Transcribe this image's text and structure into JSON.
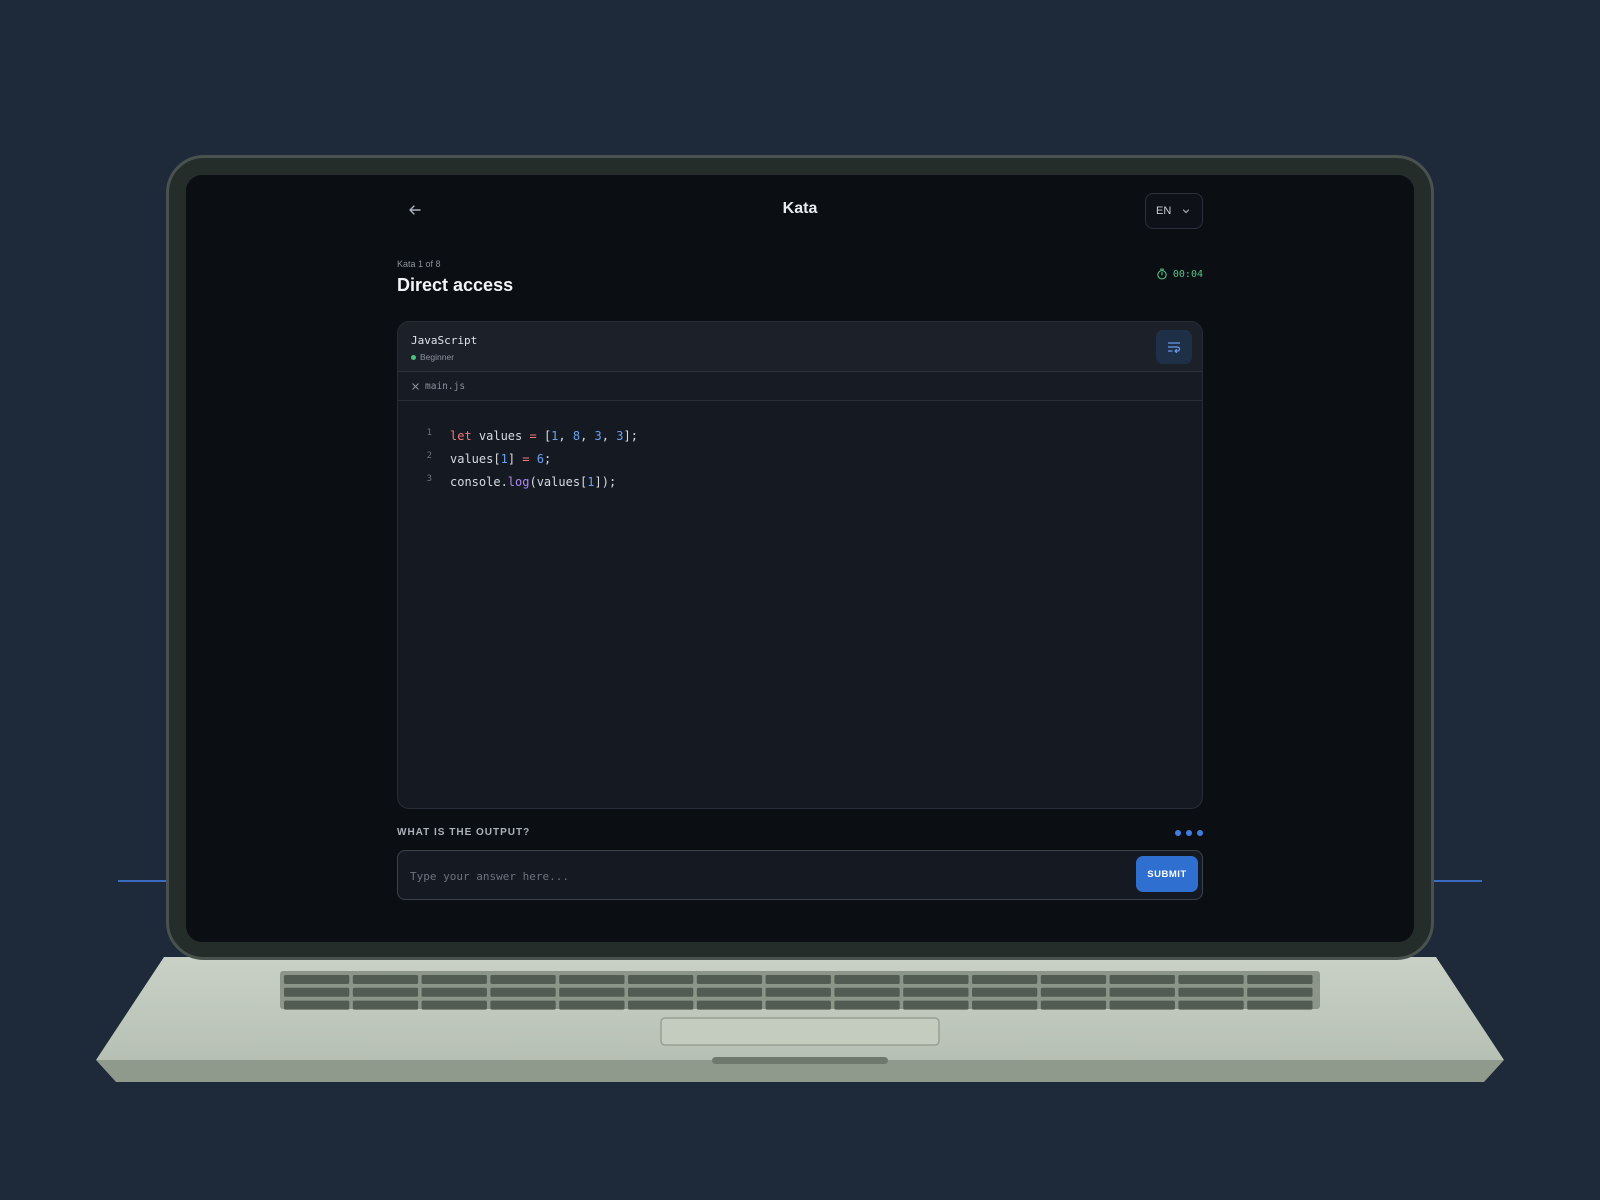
{
  "header": {
    "title": "Kata",
    "language_selector": "EN"
  },
  "kata": {
    "counter": "Kata 1 of 8",
    "title": "Direct access",
    "timer": "00:04"
  },
  "code_card": {
    "language": "JavaScript",
    "level": "Beginner",
    "filename": "main.js",
    "lines": [
      {
        "number": "1",
        "tokens": [
          {
            "t": "let",
            "c": "kw"
          },
          {
            "t": " values ",
            "c": ""
          },
          {
            "t": "=",
            "c": "kw"
          },
          {
            "t": " [",
            "c": ""
          },
          {
            "t": "1",
            "c": "num"
          },
          {
            "t": ", ",
            "c": ""
          },
          {
            "t": "8",
            "c": "num"
          },
          {
            "t": ", ",
            "c": ""
          },
          {
            "t": "3",
            "c": "num"
          },
          {
            "t": ", ",
            "c": ""
          },
          {
            "t": "3",
            "c": "num"
          },
          {
            "t": "];",
            "c": ""
          }
        ]
      },
      {
        "number": "2",
        "tokens": [
          {
            "t": "values[",
            "c": ""
          },
          {
            "t": "1",
            "c": "num"
          },
          {
            "t": "] ",
            "c": ""
          },
          {
            "t": "=",
            "c": "kw"
          },
          {
            "t": " ",
            "c": ""
          },
          {
            "t": "6",
            "c": "num"
          },
          {
            "t": ";",
            "c": ""
          }
        ]
      },
      {
        "number": "3",
        "tokens": [
          {
            "t": "console.",
            "c": ""
          },
          {
            "t": "log",
            "c": "fn"
          },
          {
            "t": "(values[",
            "c": ""
          },
          {
            "t": "1",
            "c": "num"
          },
          {
            "t": "]);",
            "c": ""
          }
        ]
      }
    ]
  },
  "question": {
    "label": "WHAT IS THE OUTPUT?",
    "placeholder": "Type your answer here...",
    "submit_label": "SUBMIT"
  },
  "colors": {
    "accent": "#2f6fd0",
    "timer": "#56c28b",
    "keyword": "#f07a7a",
    "number": "#6aa0f0",
    "function": "#a98cf0"
  }
}
